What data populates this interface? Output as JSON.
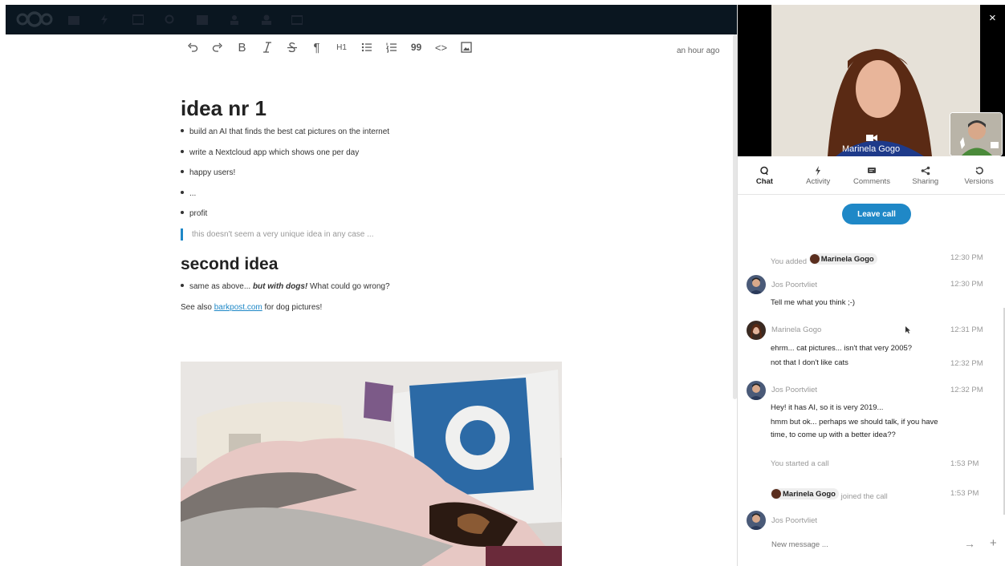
{
  "editor": {
    "last_saved": "an hour ago",
    "toolbar": {
      "undo_icon": "undo-icon",
      "redo_icon": "redo-icon",
      "bold": "B",
      "heading": "H1",
      "paragraph": "¶",
      "quote": "99",
      "code": "<>"
    }
  },
  "document": {
    "heading1": "idea nr 1",
    "list1": [
      "build an AI that finds the best cat pictures on the internet",
      "write a Nextcloud app which shows one per day",
      "happy users!",
      "...",
      "profit"
    ],
    "quote": "this doesn't seem a very unique idea in any case ...",
    "heading2": "second idea",
    "list2_prefix": "same as above... ",
    "list2_emphasis": "but with dogs!",
    "list2_suffix": " What could go wrong?",
    "para_prefix": "See also ",
    "para_link": "barkpost.com",
    "para_suffix": " for dog pictures!"
  },
  "sidebar": {
    "close_label": "×",
    "video_name": "Marinela Gogo",
    "tabs": [
      {
        "label": "Chat",
        "icon": "chat-icon"
      },
      {
        "label": "Activity",
        "icon": "activity-icon"
      },
      {
        "label": "Comments",
        "icon": "comments-icon"
      },
      {
        "label": "Sharing",
        "icon": "sharing-icon"
      },
      {
        "label": "Versions",
        "icon": "versions-icon"
      }
    ],
    "leave_call": "Leave call",
    "messages": {
      "sys1_prefix": "You added",
      "sys1_user": "Marinela Gogo",
      "sys1_time": "12:30 PM",
      "m1_author": "Jos Poortvliet",
      "m1_time": "12:30 PM",
      "m1_text": "Tell me what you think ;-)",
      "m2_author": "Marinela Gogo",
      "m2_time": "12:31 PM",
      "m2_text1": "ehrm... cat pictures... isn't that very 2005?",
      "m2_text2": "not that I don't like cats",
      "m2_time2": "12:32 PM",
      "m3_author": "Jos Poortvliet",
      "m3_time": "12:32 PM",
      "m3_text1": "Hey! it has AI, so it is very 2019...",
      "m3_text2": "hmm but ok... perhaps we should talk, if you have time, to come up with a better idea??",
      "sys2": "You started a call",
      "sys2_time": "1:53 PM",
      "sys3_user": "Marinela Gogo",
      "sys3_suffix": "joined the call",
      "sys3_time": "1:53 PM",
      "m4_author": "Jos Poortvliet"
    },
    "new_message_placeholder": "New message ...",
    "send_icon": "→",
    "plus_icon": "+"
  }
}
